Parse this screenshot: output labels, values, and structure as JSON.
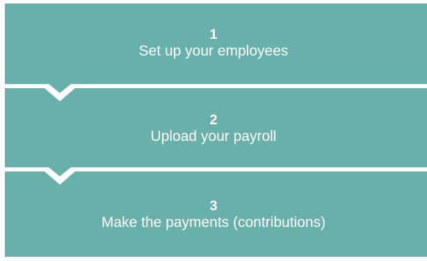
{
  "colors": {
    "step_fill": "#68b1ab",
    "separator": "#ffffff",
    "text": "#ffffff"
  },
  "steps": [
    {
      "number": "1",
      "label": "Set up your employees"
    },
    {
      "number": "2",
      "label": "Upload your payroll"
    },
    {
      "number": "3",
      "label": "Make the payments (contributions)"
    }
  ]
}
